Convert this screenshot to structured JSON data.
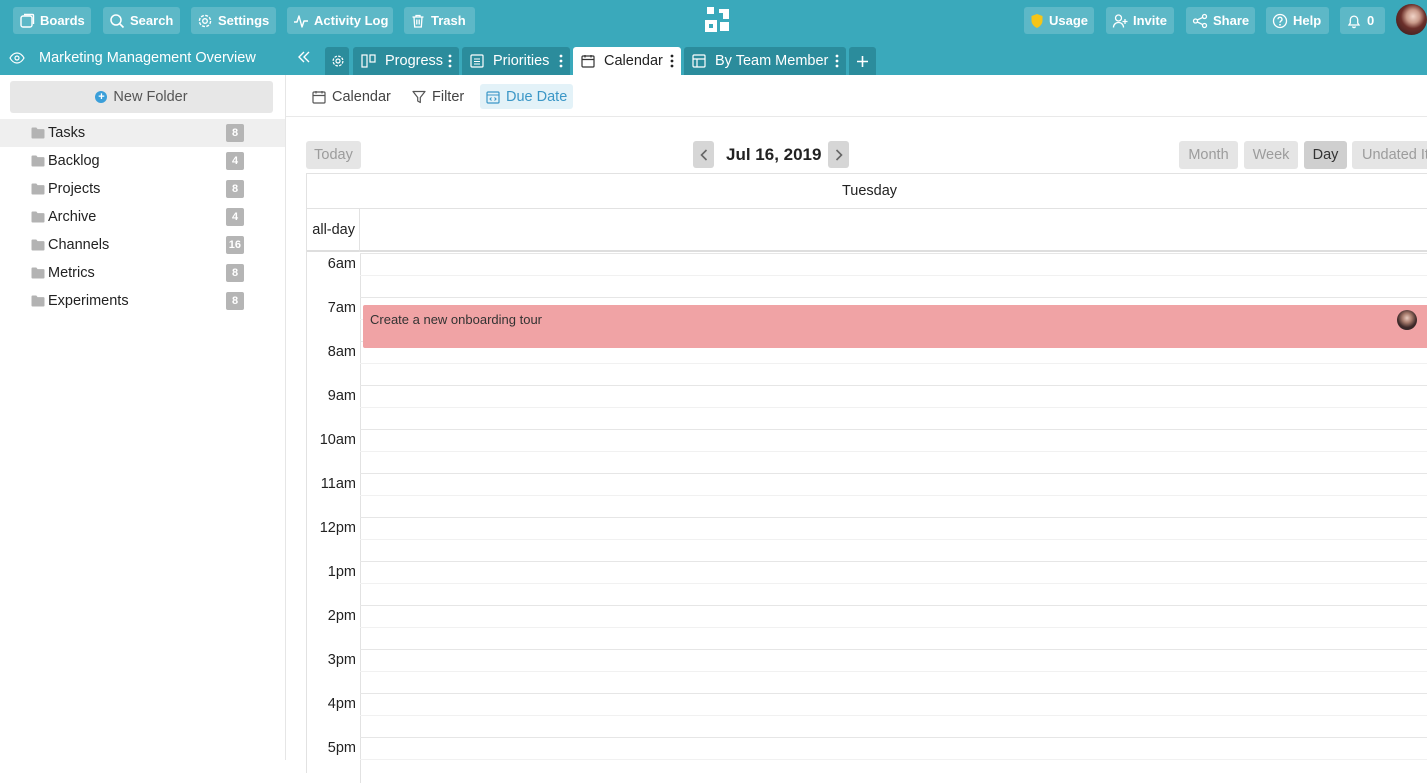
{
  "topbar": {
    "boards": "Boards",
    "search": "Search",
    "settings": "Settings",
    "activity_log": "Activity Log",
    "trash": "Trash",
    "usage": "Usage",
    "invite": "Invite",
    "share": "Share",
    "help": "Help",
    "notifications_count": "0"
  },
  "tabbar": {
    "board_title": "Marketing Management Overview",
    "tabs": [
      {
        "label": "Progress"
      },
      {
        "label": "Priorities"
      },
      {
        "label": "Calendar"
      },
      {
        "label": "By Team Member"
      }
    ]
  },
  "sidebar": {
    "new_folder": "New Folder",
    "folders": [
      {
        "label": "Tasks",
        "count": "8"
      },
      {
        "label": "Backlog",
        "count": "4"
      },
      {
        "label": "Projects",
        "count": "8"
      },
      {
        "label": "Archive",
        "count": "4"
      },
      {
        "label": "Channels",
        "count": "16"
      },
      {
        "label": "Metrics",
        "count": "8"
      },
      {
        "label": "Experiments",
        "count": "8"
      }
    ]
  },
  "toolbar": {
    "calendar": "Calendar",
    "filter": "Filter",
    "due_date": "Due Date"
  },
  "calendar": {
    "today": "Today",
    "date_title": "Jul 16, 2019",
    "views": {
      "month": "Month",
      "week": "Week",
      "day": "Day",
      "undated": "Undated It"
    },
    "day_header": "Tuesday",
    "allday": "all-day",
    "hours": [
      "6am",
      "7am",
      "8am",
      "9am",
      "10am",
      "11am",
      "12pm",
      "1pm",
      "2pm",
      "3pm",
      "4pm",
      "5pm"
    ],
    "event": {
      "title": "Create a new onboarding tour"
    }
  },
  "colors": {
    "header": "#3aa9bb",
    "tab_inactive": "#2b8c9c",
    "event": "#f0a3a5",
    "usage_shield": "#f5c518",
    "accent_blue": "#3b9fd9"
  }
}
